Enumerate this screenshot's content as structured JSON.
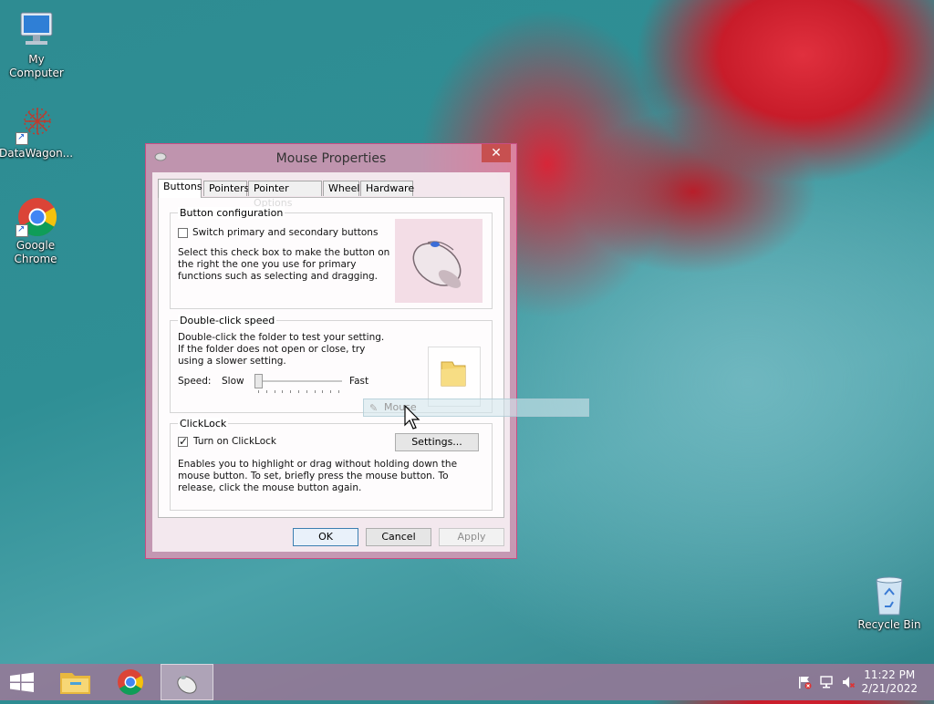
{
  "desktop": {
    "icons": [
      {
        "label": "My Computer"
      },
      {
        "label": "DataWagon..."
      },
      {
        "label": "Google Chrome"
      },
      {
        "label": "Recycle Bin"
      }
    ]
  },
  "dialog": {
    "title": "Mouse Properties",
    "close_glyph": "✕",
    "tabs": [
      "Buttons",
      "Pointers",
      "Pointer Options",
      "Wheel",
      "Hardware"
    ],
    "active_tab": "Buttons",
    "button_config": {
      "legend": "Button configuration",
      "checkbox_label": "Switch primary and secondary buttons",
      "checked": false,
      "description": "Select this check box to make the button on the right the one you use for primary functions such as selecting and dragging."
    },
    "double_click": {
      "legend": "Double-click speed",
      "description": "Double-click the folder to test your setting. If the folder does not open or close, try using a slower setting.",
      "speed_label": "Speed:",
      "slow_label": "Slow",
      "fast_label": "Fast",
      "speed_fraction": 0.0
    },
    "clicklock": {
      "legend": "ClickLock",
      "checkbox_label": "Turn on ClickLock",
      "checked": true,
      "settings_button": "Settings...",
      "description": "Enables you to highlight or drag without holding down the mouse button. To set, briefly press the mouse button. To release, click the mouse button again."
    },
    "buttons": {
      "ok": "OK",
      "cancel": "Cancel",
      "apply": "Apply"
    }
  },
  "drag_ghost": {
    "label": "Mouse"
  },
  "taskbar": {
    "items": [
      "start-icon",
      "file-explorer-icon",
      "chrome-icon",
      "mouse-properties-icon"
    ],
    "tray": [
      "flag-icon",
      "network-icon",
      "volume-muted-icon"
    ],
    "time": "11:22 PM",
    "date": "2/21/2022"
  }
}
